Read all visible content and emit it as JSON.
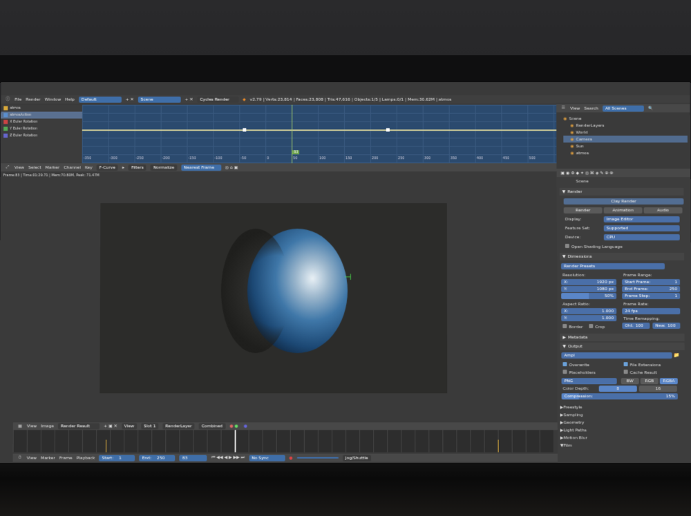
{
  "top_bar": {
    "menus": [
      "File",
      "Render",
      "Window",
      "Help"
    ],
    "layout": "Default",
    "scene": "Scene",
    "engine": "Cycles Render",
    "stats": "v2.79 | Verts:23,814 | Faces:23,808 | Tris:47,616 | Objects:1/5 | Lamps:0/1 | Mem:30.62M | atmos"
  },
  "graph_channels": [
    {
      "label": "atmos",
      "color": "#d9a93a"
    },
    {
      "label": "atmosAction",
      "color": "#5a8fcf"
    },
    {
      "label": "X Euler Rotation",
      "color": "#cc4444"
    },
    {
      "label": "Y Euler Rotation",
      "color": "#55aa55"
    },
    {
      "label": "Z Euler Rotation",
      "color": "#6666cc"
    }
  ],
  "graph_ticks": [
    "-350",
    "-300",
    "-250",
    "-200",
    "-150",
    "-100",
    "-50",
    "0",
    "50",
    "100",
    "150",
    "200",
    "250",
    "300",
    "350",
    "400",
    "450",
    "500"
  ],
  "graph_current_frame": "83",
  "graph_header": {
    "menus": [
      "View",
      "Select",
      "Marker",
      "Channel",
      "Key"
    ],
    "mode": "F-Curve",
    "filters": "Filters",
    "normalize": "Normalize",
    "snap": "Nearest Frame"
  },
  "render_info": "Frame:83 | Time:01:29.71 | Mem:70.80M, Peak: 71.47M",
  "image_header": {
    "menus": [
      "View",
      "Image"
    ],
    "image": "Render Result",
    "view": "View",
    "slot": "Slot 1",
    "layer": "RenderLayer",
    "pass": "Combined"
  },
  "timeline_header": {
    "menus": [
      "View",
      "Marker",
      "Frame",
      "Playback"
    ],
    "start_label": "Start:",
    "start": "1",
    "end_label": "End:",
    "end": "250",
    "current": "83",
    "sync": "No Sync",
    "keying": "Jog/Shuttle"
  },
  "outliner": {
    "menus": [
      "View",
      "Search"
    ],
    "filter": "All Scenes",
    "items": [
      {
        "label": "Scene",
        "indent": 0
      },
      {
        "label": "RenderLayers",
        "indent": 1
      },
      {
        "label": "World",
        "indent": 1
      },
      {
        "label": "Camera",
        "indent": 1,
        "selected": true
      },
      {
        "label": "Sun",
        "indent": 1
      },
      {
        "label": "atmos",
        "indent": 1
      }
    ]
  },
  "properties": {
    "context": "Scene",
    "render_panel": "Render",
    "clay_render": "Clay Render",
    "render_buttons": [
      "Render",
      "Animation",
      "Audio"
    ],
    "display_label": "Display:",
    "display_value": "Image Editor",
    "feature_label": "Feature Set:",
    "feature_value": "Supported",
    "device_label": "Device:",
    "device_value": "CPU",
    "osl": "Open Shading Language",
    "dimensions_panel": "Dimensions",
    "presets": "Render Presets",
    "resolution_label": "Resolution:",
    "res_x": "X:",
    "res_x_val": "1920 px",
    "res_y": "Y:",
    "res_y_val": "1080 px",
    "res_pct": "50%",
    "frame_range_label": "Frame Range:",
    "start_frame": "Start Frame:",
    "start_frame_val": "1",
    "end_frame": "End Frame:",
    "end_frame_val": "250",
    "frame_step": "Frame Step:",
    "frame_step_val": "1",
    "aspect_label": "Aspect Ratio:",
    "asp_x": "X:",
    "asp_x_val": "1.000",
    "asp_y": "Y:",
    "asp_y_val": "1.000",
    "frame_rate_label": "Frame Rate:",
    "frame_rate": "24 fps",
    "time_remap": "Time Remapping:",
    "old": "Old:",
    "old_val": "100",
    "new": "New:",
    "new_val": "100",
    "border": "Border",
    "crop": "Crop",
    "metadata_panel": "Metadata",
    "output_panel": "Output",
    "output_path": "Ampl",
    "overwrite": "Overwrite",
    "file_ext": "File Extensions",
    "placeholders": "Placeholders",
    "cache_result": "Cache Result",
    "format": "PNG",
    "color_modes": [
      "BW",
      "RGB",
      "RGBA"
    ],
    "color_depth_label": "Color Depth:",
    "color_depth_8": "8",
    "color_depth_16": "16",
    "compression_label": "Compression:",
    "compression_val": "15%",
    "collapsed_panels": [
      "Freestyle",
      "Sampling",
      "Geometry",
      "Light Paths",
      "Motion Blur",
      "Film"
    ]
  }
}
